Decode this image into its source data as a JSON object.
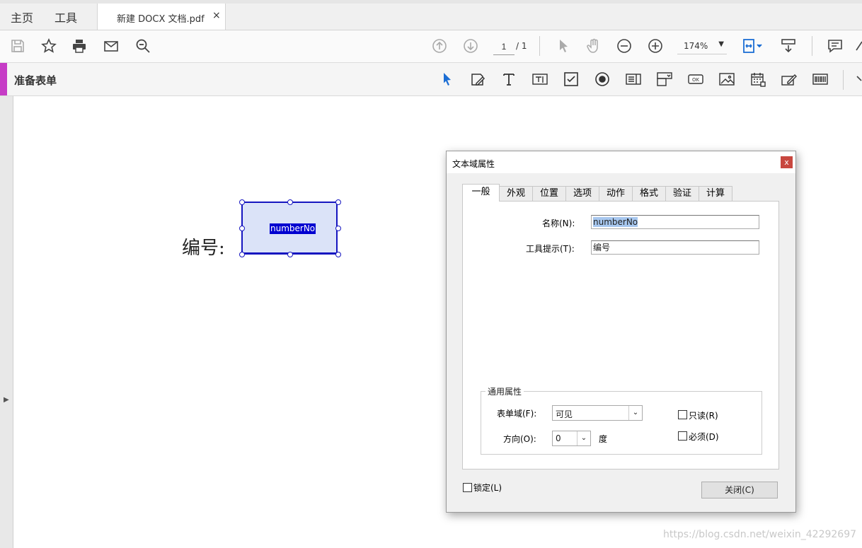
{
  "nav_tabs": [
    "主页",
    "工具"
  ],
  "document_tab": {
    "title": "新建 DOCX 文档.pdf",
    "close": "×"
  },
  "toolbar": {
    "left_icons": [
      "save-icon",
      "star-icon",
      "print-icon",
      "email-icon",
      "search-icon"
    ],
    "page_current": "1",
    "page_total": "/ 1",
    "zoom": "174%",
    "right_icons": [
      "page-up-icon",
      "page-down-icon",
      "select-cursor-icon",
      "hand-icon",
      "zoom-out-icon",
      "zoom-in-icon",
      "fit-page-icon",
      "scroll-mode-icon",
      "comment-icon"
    ]
  },
  "form_toolbar": {
    "title": "准备表单",
    "icons": [
      "select-arrow-icon",
      "edit-form-icon",
      "add-text-icon",
      "text-field-icon",
      "checkbox-icon",
      "radio-button-icon",
      "list-box-icon",
      "dropdown-icon",
      "button-field-icon",
      "image-field-icon",
      "date-field-icon",
      "signature-field-icon",
      "barcode-icon"
    ]
  },
  "document": {
    "label": "编号:",
    "field_name": "numberNo"
  },
  "dialog": {
    "title": "文本域属性",
    "close": "x",
    "tabs": [
      "一般",
      "外观",
      "位置",
      "选项",
      "动作",
      "格式",
      "验证",
      "计算"
    ],
    "active_tab": "一般",
    "name_label": "名称(N):",
    "name_value": "numberNo",
    "tooltip_label": "工具提示(T):",
    "tooltip_value": "编号",
    "common_props": "通用属性",
    "form_field_label": "表单域(F):",
    "form_field_value": "可见",
    "orientation_label": "方向(O):",
    "orientation_value": "0",
    "degree": "度",
    "readonly_label": "只读(R)",
    "required_label": "必须(D)",
    "locked_label": "锁定(L)",
    "close_button": "关闭(C)"
  },
  "watermark": "https://blog.csdn.net/weixin_42292697"
}
